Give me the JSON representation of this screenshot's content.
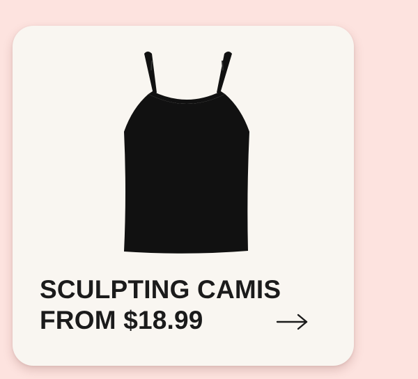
{
  "card": {
    "headline_line1": "SCULPTING CAMIS",
    "headline_line2": "FROM $18.99",
    "image_icon": "black-camisole-image",
    "arrow_icon": "arrow-right-icon"
  },
  "colors": {
    "page_background": "#fde3df",
    "card_background": "#f9f6f1",
    "text": "#1b1b1b",
    "product": "#111111"
  }
}
